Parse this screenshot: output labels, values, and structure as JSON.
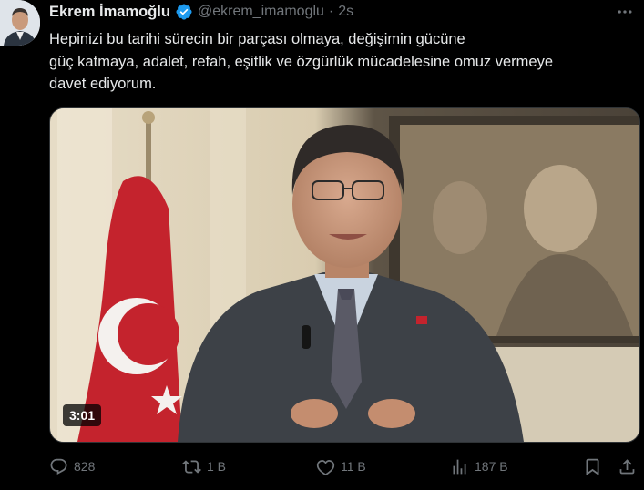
{
  "tweet": {
    "author_name": "Ekrem İmamoğlu",
    "handle": "@ekrem_imamoglu",
    "separator": "·",
    "time": "2s",
    "text_lines": [
      "Hepinizi bu tarihi sürecin bir parçası olmaya, değişimin gücüne",
      "güç katmaya, adalet, refah, eşitlik ve özgürlük mücadelesine omuz vermeye",
      "davet ediyorum."
    ],
    "video": {
      "duration": "3:01"
    },
    "actions": {
      "replies": "828",
      "reposts": "1 B",
      "likes": "11 B",
      "views": "187 B"
    }
  },
  "colors": {
    "background": "#000000",
    "text_primary": "#e7e9ea",
    "text_secondary": "#71767b",
    "verified_badge": "#1d9bf0"
  },
  "icons": {
    "more": "more-icon",
    "reply": "reply-icon",
    "repost": "repost-icon",
    "like": "heart-icon",
    "views": "views-icon",
    "bookmark": "bookmark-icon",
    "share": "share-icon",
    "verified": "verified-badge-icon"
  }
}
